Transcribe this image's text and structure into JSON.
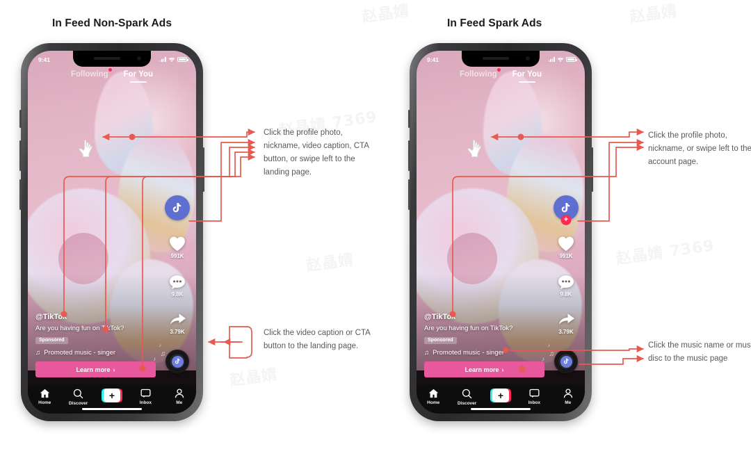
{
  "watermark": {
    "text": "赵晶婧 7369",
    "short": "赵晶婧"
  },
  "panels": [
    {
      "id": "non-spark",
      "title": "In Feed Non-Spark Ads",
      "annotations": [
        {
          "id": "top",
          "text": "Click the profile photo, nickname, video caption, CTA button, or swipe left to the landing page."
        },
        {
          "id": "bottom",
          "text": "Click the video caption or CTA button to the landing page."
        }
      ]
    },
    {
      "id": "spark",
      "title": "In Feed Spark Ads",
      "annotations": [
        {
          "id": "top",
          "text": "Click the profile photo, nickname, or swipe left to the account page."
        },
        {
          "id": "bottom",
          "text": "Click the music name or music disc to the music page"
        }
      ]
    }
  ],
  "phone": {
    "status": {
      "time": "9:41",
      "signal_icon": "signal-bars-icon",
      "wifi_icon": "wifi-icon",
      "battery_icon": "battery-icon"
    },
    "feed_tabs": [
      {
        "label": "Following",
        "active": false,
        "badge": true
      },
      {
        "label": "For You",
        "active": true,
        "badge": false
      }
    ],
    "rail": {
      "avatar_icon": "tiktok-note-icon",
      "follow_badge": "+",
      "items": [
        {
          "icon": "heart-icon",
          "count": "991K"
        },
        {
          "icon": "comment-icon",
          "count": "9.8K"
        },
        {
          "icon": "share-icon",
          "count": "3.79K"
        }
      ]
    },
    "music_disc_icon": "music-disc-icon",
    "caption": {
      "handle": "@TikTok",
      "text": "Are you having fun on TikTok?",
      "sponsored_label": "Sponsored",
      "music_icon": "music-note-icon",
      "music_text": "Promoted music - singer",
      "cta_label": "Learn more",
      "cta_chevron": "›"
    },
    "bottom_nav": [
      {
        "icon": "home-icon",
        "label": "Home"
      },
      {
        "icon": "search-icon",
        "label": "Discover"
      },
      {
        "icon": "plus-icon",
        "label": ""
      },
      {
        "icon": "inbox-icon",
        "label": "Inbox"
      },
      {
        "icon": "person-icon",
        "label": "Me"
      }
    ]
  },
  "colors": {
    "accent_red": "#e8594f",
    "tiktok_pink": "#fe2c55",
    "cta_pink": "#e8589c",
    "avatar_blue": "#5f6fd1",
    "text_gray": "#595959"
  }
}
